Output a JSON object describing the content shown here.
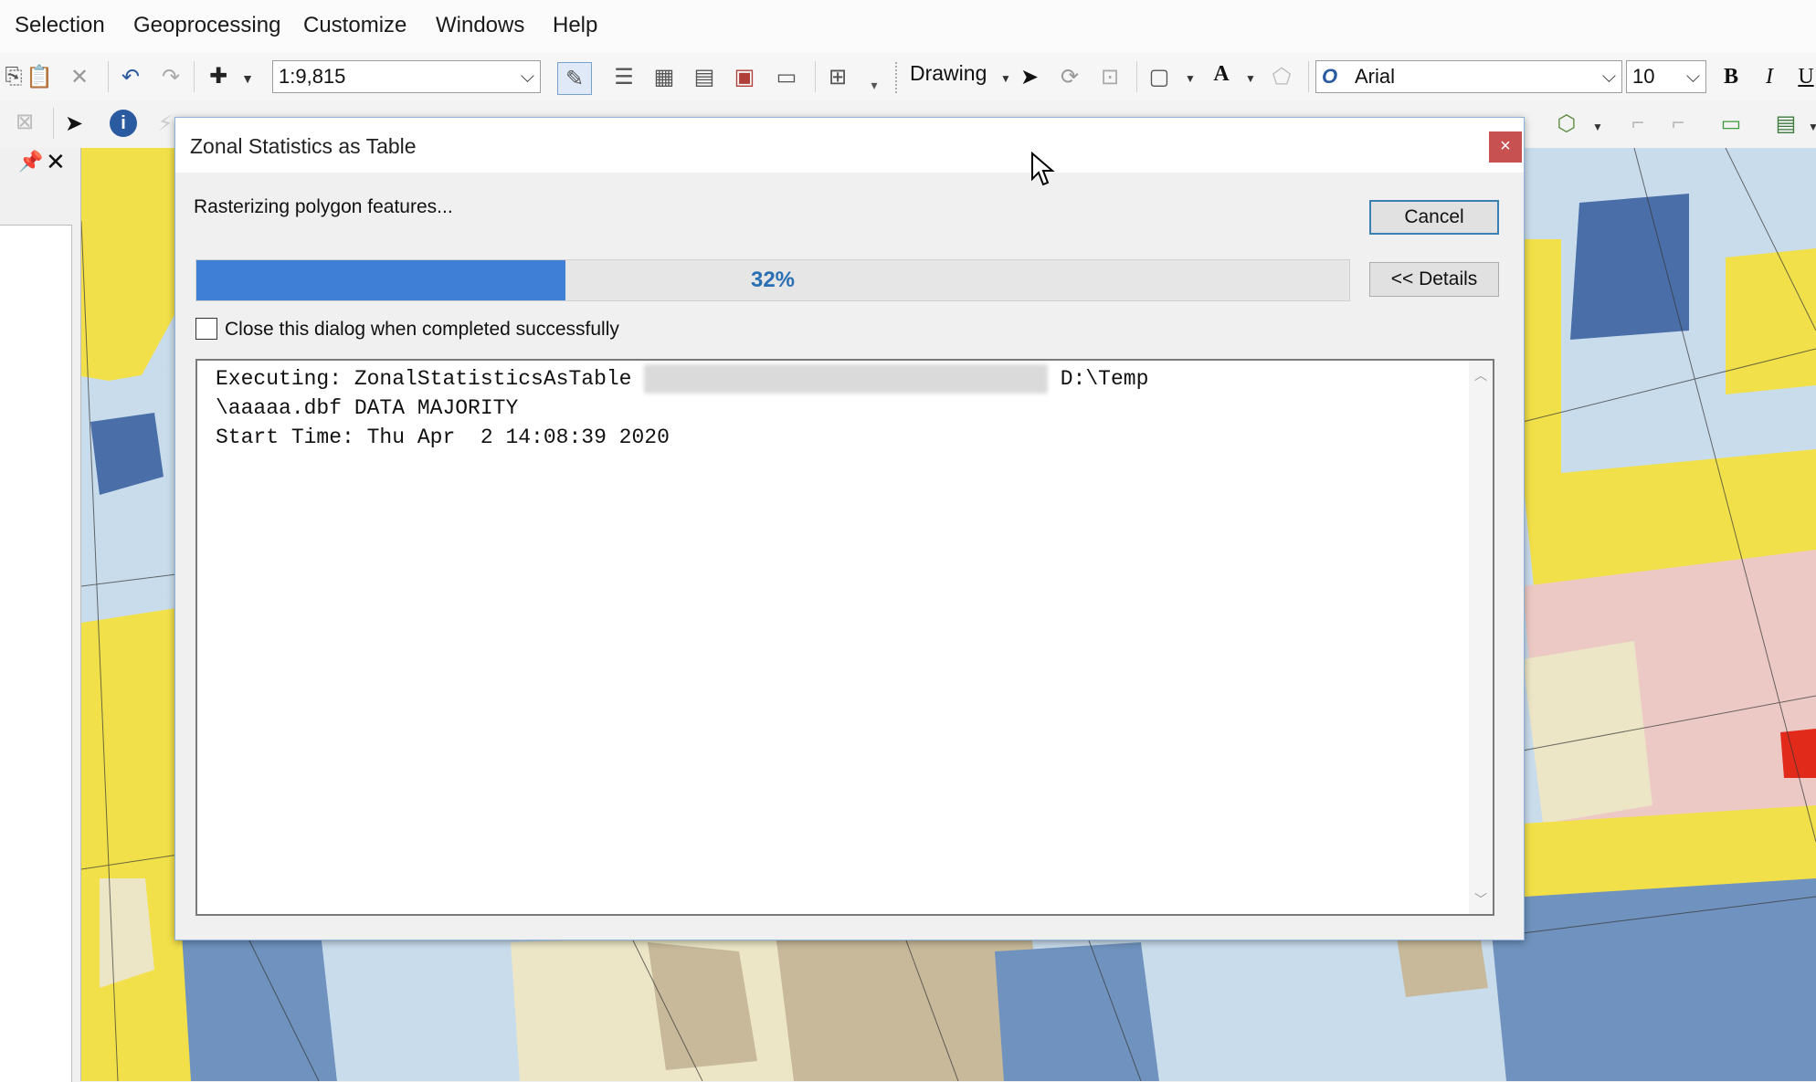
{
  "menu": {
    "items": [
      "Selection",
      "Geoprocessing",
      "Customize",
      "Windows",
      "Help"
    ]
  },
  "toolbar": {
    "scale_value": "1:9,815",
    "drawing_label": "Drawing",
    "font_name": "Arial",
    "font_size": "10",
    "bold_label": "B",
    "italic_label": "I",
    "underline_label": "U",
    "text_tool_label": "A"
  },
  "dialog": {
    "title": "Zonal Statistics as Table",
    "close_label": "×",
    "status": "Rasterizing polygon features...",
    "cancel_label": "Cancel",
    "details_label": "<< Details",
    "progress_percent": 32,
    "progress_label": "32%",
    "close_when_done_label": "Close this dialog when completed successfully",
    "close_when_done_checked": false,
    "log": {
      "line1_prefix": "Executing: ZonalStatisticsAsTable ",
      "line1_suffix": " D:\\Temp",
      "line2": "\\aaaaa.dbf DATA MAJORITY",
      "line3": "Start Time: Thu Apr  2 14:08:39 2020"
    }
  },
  "colors": {
    "progress_fill": "#3f7fd6",
    "close_button": "#c75050",
    "map_yellow": "#f2e04a",
    "map_lightblue": "#c9dcec",
    "map_blue": "#6f93be",
    "map_darkblue": "#4a6fa8",
    "map_beige": "#ece6c6",
    "map_tan": "#c7b99a",
    "map_pink": "#ecc9c4",
    "map_red": "#e12a1a"
  }
}
